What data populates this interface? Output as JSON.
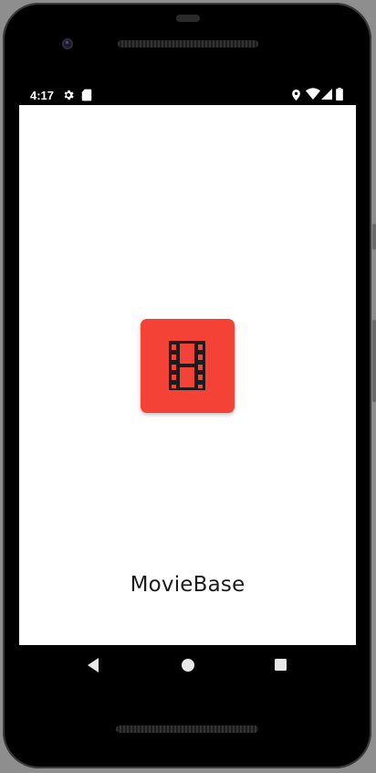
{
  "status_bar": {
    "time": "4:17",
    "left_icons": [
      "settings-icon",
      "sd-card-icon"
    ],
    "right_icons": [
      "location-icon",
      "wifi-icon",
      "signal-icon",
      "battery-icon"
    ]
  },
  "splash": {
    "app_name": "MovieBase",
    "logo_icon": "film-strip-icon",
    "logo_color": "#f44336"
  },
  "nav_bar": {
    "buttons": [
      "back-button",
      "home-button",
      "recents-button"
    ]
  }
}
